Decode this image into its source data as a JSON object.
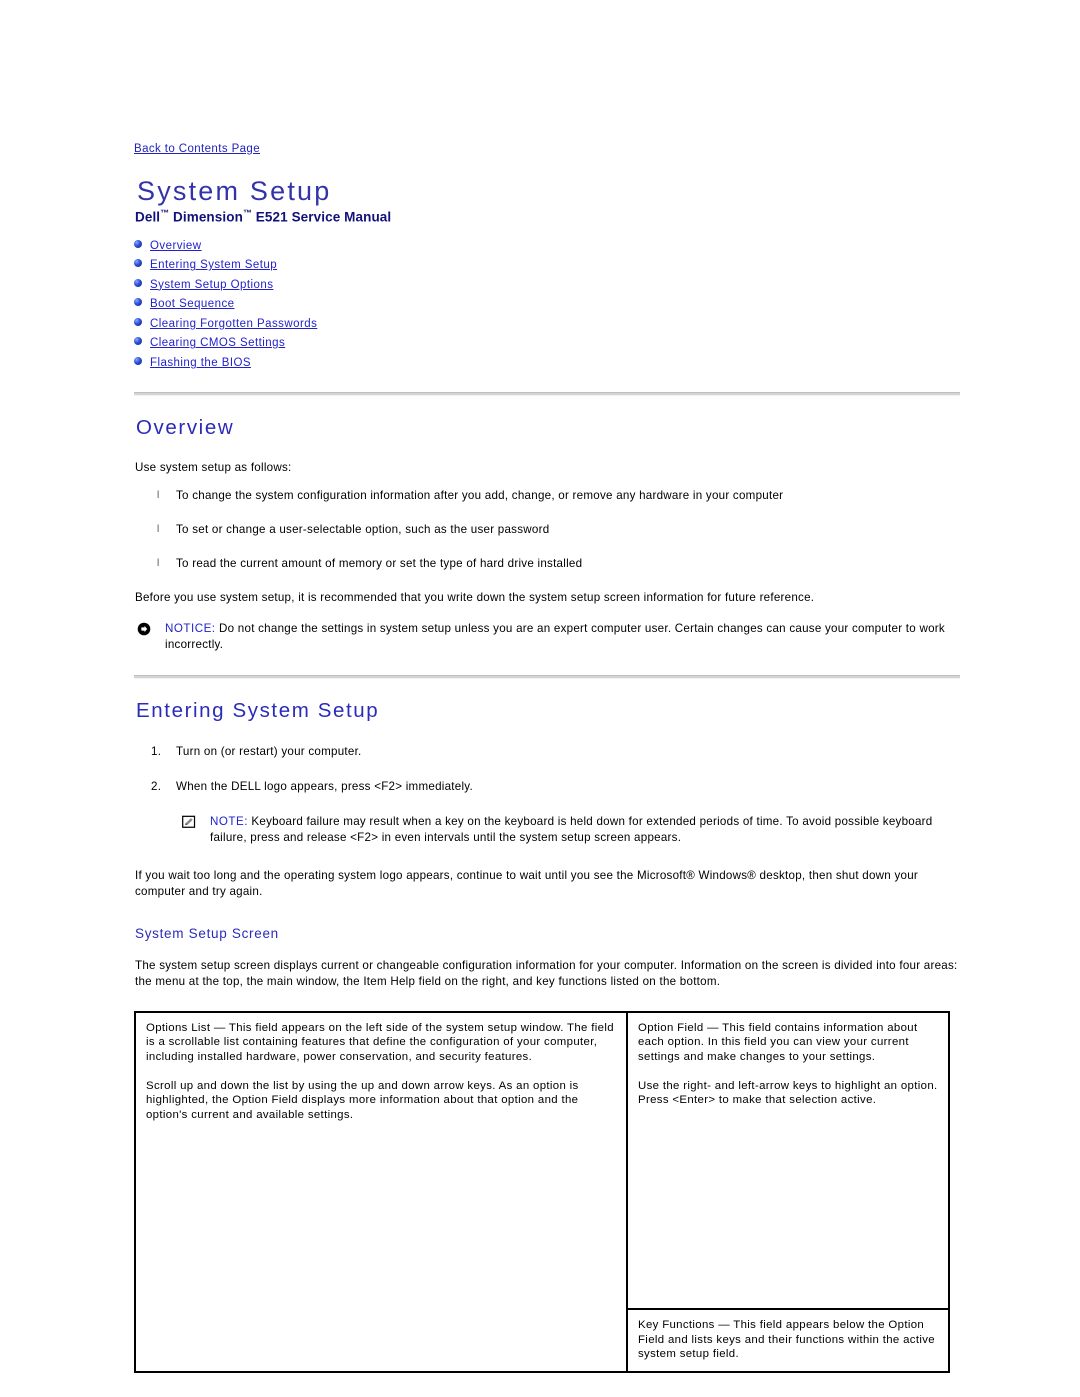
{
  "nav": {
    "back_link": "Back to Contents Page"
  },
  "header": {
    "title": "System Setup",
    "subtitle_brand": "Dell",
    "subtitle_tm1": "™",
    "subtitle_product": " Dimension",
    "subtitle_tm2": "™",
    "subtitle_rest": " E521 Service Manual"
  },
  "toc": {
    "items": [
      {
        "label": "Overview"
      },
      {
        "label": "Entering System Setup"
      },
      {
        "label": "System Setup Options"
      },
      {
        "label": "Boot Sequence"
      },
      {
        "label": "Clearing Forgotten Passwords"
      },
      {
        "label": "Clearing CMOS Settings"
      },
      {
        "label": "Flashing the BIOS"
      }
    ]
  },
  "overview": {
    "heading": "Overview",
    "intro": "Use system setup as follows:",
    "bullets": [
      "To change the system configuration information after you add, change, or remove any hardware in your computer",
      "To set or change a user-selectable option, such as the user password",
      "To read the current amount of memory or set the type of hard drive installed"
    ],
    "after": "Before you use system setup, it is recommended that you write down the system setup screen information for future reference.",
    "notice_label": "NOTICE:",
    "notice_text": " Do not change the settings in system setup unless you are an expert computer user. Certain changes can cause your computer to work incorrectly."
  },
  "entering": {
    "heading": "Entering System Setup",
    "steps": [
      {
        "num": "1.",
        "text": "Turn on (or restart) your computer."
      },
      {
        "num": "2.",
        "text": "When the DELL logo appears, press <F2> immediately."
      }
    ],
    "note_label": "NOTE:",
    "note_text": " Keyboard failure may result when a key on the keyboard is held down for extended periods of time. To avoid possible keyboard failure, press and release <F2> in even intervals until the system setup screen appears.",
    "paragraph": "If you wait too long and the operating system logo appears, continue to wait until you see the Microsoft® Windows® desktop, then shut down your computer and try again."
  },
  "screen": {
    "heading": "System Setup Screen",
    "paragraph": "The system setup screen displays current or changeable configuration information for your computer. Information on the screen is divided into four areas: the menu at the top, the main window, the Item Help field on the right, and key functions listed on the bottom.",
    "table": {
      "options_list_p1": "Options List — This field appears on the left side of the system setup window. The field is a scrollable list containing features that define the configuration of your computer, including installed hardware, power conservation, and security features.",
      "options_list_p2": "Scroll up and down the list by using the up and down arrow keys. As an option is highlighted, the Option Field displays more information about that option and the option's current and available settings.",
      "option_field_p1": "Option Field — This field contains information about each option. In this field you can view your current settings and make changes to your settings.",
      "option_field_p2": "Use the right- and left-arrow keys to highlight an option. Press <Enter> to make that selection active.",
      "key_functions": "Key Functions — This field appears below the Option Field and lists keys and their functions within the active system setup field."
    }
  },
  "colors": {
    "link": "#2222cc",
    "title": "#3333aa",
    "heading": "#2b2bbb",
    "subtitle": "#11117a",
    "rule": "#d4d4d4"
  },
  "icons": {
    "notice": "notice-arrow-icon",
    "note": "note-pencil-icon",
    "bullet": "blue-sphere-bullet-icon"
  }
}
